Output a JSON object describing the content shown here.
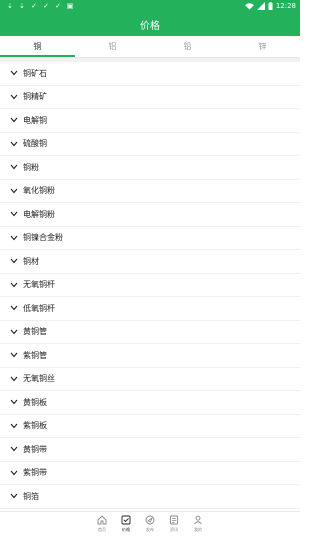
{
  "status_bar": {
    "time": "12:28",
    "left_icons": [
      "download-icon",
      "download-icon",
      "check-icon",
      "check-icon",
      "check-icon",
      "app-icon"
    ],
    "right_icons": [
      "wifi-icon",
      "signal-icon",
      "battery-icon"
    ]
  },
  "header": {
    "title": "价格"
  },
  "tabs": [
    {
      "label": "铜",
      "active": true
    },
    {
      "label": "铝",
      "active": false
    },
    {
      "label": "铅",
      "active": false
    },
    {
      "label": "锌",
      "active": false
    }
  ],
  "list": [
    "铜矿石",
    "铜精矿",
    "电解铜",
    "硫酸铜",
    "铜粉",
    "氧化铜粉",
    "电解铜粉",
    "铜镍合金粉",
    "铜材",
    "无氧铜杆",
    "低氧铜杆",
    "黄铜管",
    "紫铜管",
    "无氧铜丝",
    "黄铜板",
    "紫铜板",
    "黄铜带",
    "紫铜带",
    "铜箔"
  ],
  "bottom_nav": [
    {
      "label": "首页",
      "icon": "home-icon",
      "active": false
    },
    {
      "label": "价格",
      "icon": "price-icon",
      "active": true
    },
    {
      "label": "发布",
      "icon": "publish-icon",
      "active": false
    },
    {
      "label": "资讯",
      "icon": "news-icon",
      "active": false
    },
    {
      "label": "我的",
      "icon": "user-icon",
      "active": false
    }
  ],
  "colors": {
    "primary": "#23b15c",
    "divider": "#efefef"
  }
}
